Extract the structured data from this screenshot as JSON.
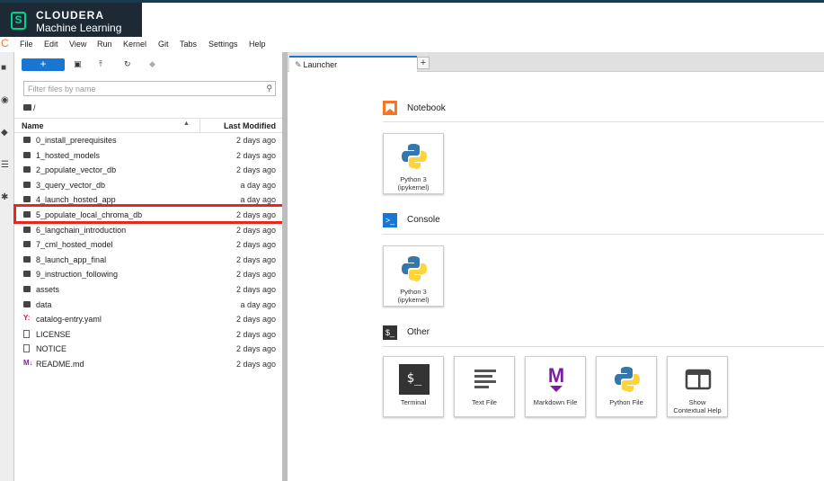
{
  "brand": {
    "logo_letter": "S",
    "line1": "CLOUDERA",
    "line2": "Machine Learning"
  },
  "menu": [
    "File",
    "Edit",
    "View",
    "Run",
    "Kernel",
    "Git",
    "Tabs",
    "Settings",
    "Help"
  ],
  "filebrowser": {
    "new_label": "+",
    "filter_placeholder": "Filter files by name",
    "breadcrumb": "/",
    "col_name": "Name",
    "col_modified": "Last Modified",
    "rows": [
      {
        "name": "0_install_prerequisites",
        "modified": "2 days ago",
        "type": "folder"
      },
      {
        "name": "1_hosted_models",
        "modified": "2 days ago",
        "type": "folder"
      },
      {
        "name": "2_populate_vector_db",
        "modified": "2 days ago",
        "type": "folder"
      },
      {
        "name": "3_query_vector_db",
        "modified": "a day ago",
        "type": "folder"
      },
      {
        "name": "4_launch_hosted_app",
        "modified": "a day ago",
        "type": "folder"
      },
      {
        "name": "5_populate_local_chroma_db",
        "modified": "2 days ago",
        "type": "folder"
      },
      {
        "name": "6_langchain_introduction",
        "modified": "2 days ago",
        "type": "folder"
      },
      {
        "name": "7_cml_hosted_model",
        "modified": "2 days ago",
        "type": "folder"
      },
      {
        "name": "8_launch_app_final",
        "modified": "2 days ago",
        "type": "folder"
      },
      {
        "name": "9_instruction_following",
        "modified": "2 days ago",
        "type": "folder"
      },
      {
        "name": "assets",
        "modified": "2 days ago",
        "type": "folder"
      },
      {
        "name": "data",
        "modified": "a day ago",
        "type": "folder"
      },
      {
        "name": "catalog-entry.yaml",
        "modified": "2 days ago",
        "type": "yaml"
      },
      {
        "name": "LICENSE",
        "modified": "2 days ago",
        "type": "file"
      },
      {
        "name": "NOTICE",
        "modified": "2 days ago",
        "type": "file"
      },
      {
        "name": "README.md",
        "modified": "2 days ago",
        "type": "md"
      }
    ]
  },
  "tab": {
    "label": "Launcher",
    "add": "+"
  },
  "launcher": {
    "notebook": {
      "title": "Notebook",
      "cards": [
        {
          "label1": "Python 3",
          "label2": "(ipykernel)"
        }
      ]
    },
    "console": {
      "title": "Console",
      "cards": [
        {
          "label1": "Python 3",
          "label2": "(ipykernel)"
        }
      ]
    },
    "other": {
      "title": "Other",
      "cards": [
        {
          "label1": "Terminal",
          "label2": ""
        },
        {
          "label1": "Text File",
          "label2": ""
        },
        {
          "label1": "Markdown File",
          "label2": ""
        },
        {
          "label1": "Python File",
          "label2": ""
        },
        {
          "label1": "Show",
          "label2": "Contextual Help"
        }
      ]
    },
    "terminal_glyph": "$_",
    "markdown_glyph": "M"
  },
  "colors": {
    "accent": "#1976d2",
    "highlight": "#e8281c",
    "notebook": "#f37726",
    "console": "#1976d2"
  }
}
